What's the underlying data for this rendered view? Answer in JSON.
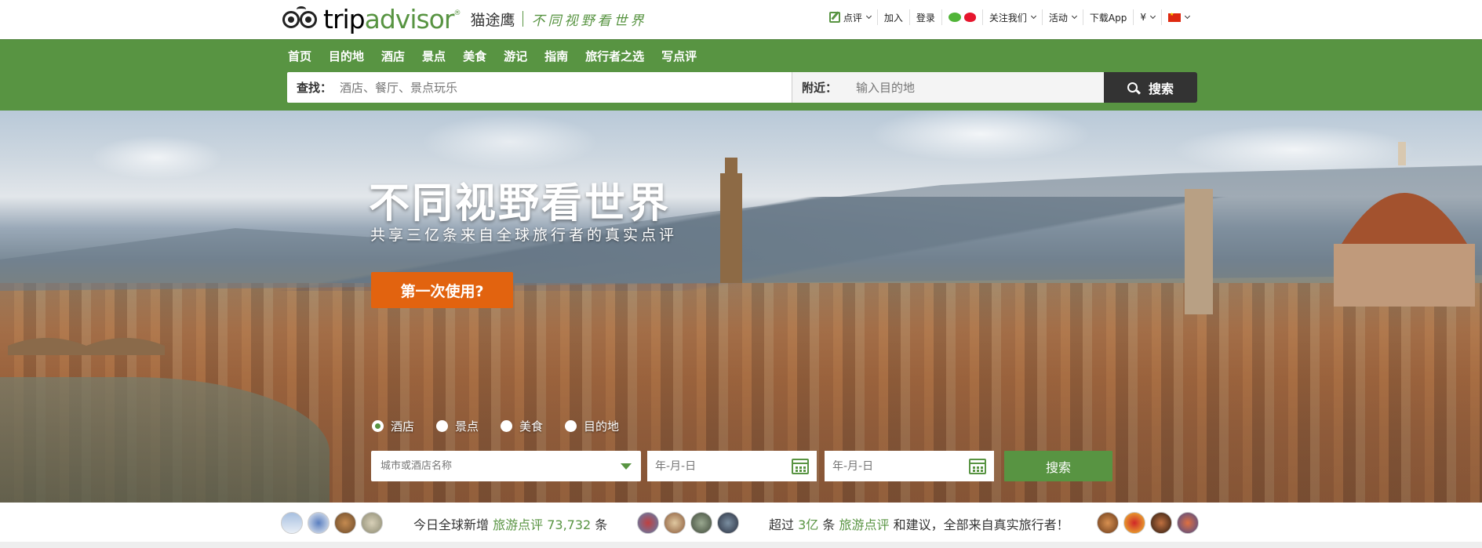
{
  "brand": {
    "trip": "trip",
    "advisor": "advisor",
    "reg": "®",
    "cn_name": "猫途鹰",
    "slogan": "不同视野看世界"
  },
  "topnav": {
    "review": "点评",
    "join": "加入",
    "login": "登录",
    "follow": "关注我们",
    "activity": "活动",
    "download": "下载App",
    "currency": "¥"
  },
  "menu": [
    "首页",
    "目的地",
    "酒店",
    "景点",
    "美食",
    "游记",
    "指南",
    "旅行者之选",
    "写点评"
  ],
  "search": {
    "find_label": "查找：",
    "find_placeholder": "酒店、餐厅、景点玩乐",
    "near_label": "附近：",
    "near_placeholder": "输入目的地",
    "button": "搜索"
  },
  "hero": {
    "title": "不同视野看世界",
    "subtitle": "共享三亿条来自全球旅行者的真实点评",
    "first_time": "第一次使用?",
    "radios": [
      {
        "label": "酒店",
        "checked": true
      },
      {
        "label": "景点",
        "checked": false
      },
      {
        "label": "美食",
        "checked": false
      },
      {
        "label": "目的地",
        "checked": false
      }
    ],
    "city_placeholder": "城市或酒店名称",
    "checkin_placeholder": "年-月-日",
    "checkout_placeholder": "年-月-日",
    "search_button": "搜索"
  },
  "stats": {
    "left_prefix": "今日全球新增",
    "left_link": "旅游点评",
    "left_count": "73,732",
    "left_suffix": "条",
    "right_prefix": "超过",
    "right_num": "3亿",
    "right_mid": "条",
    "right_link": "旅游点评",
    "right_suffix": "和建议，全部来自真实旅行者！"
  },
  "colors": {
    "brand_green": "#589442",
    "orange": "#e2630f",
    "dark_button": "#333333"
  }
}
